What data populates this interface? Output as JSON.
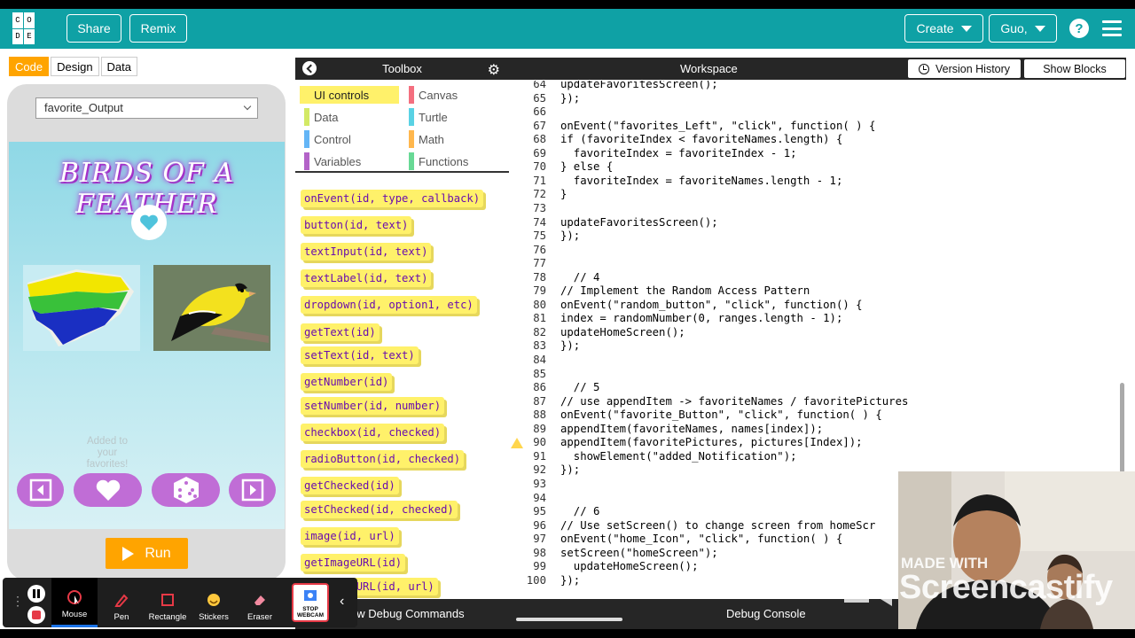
{
  "header": {
    "logo_letters": [
      "C",
      "O",
      "D",
      "E"
    ],
    "share_label": "Share",
    "remix_label": "Remix",
    "create_label": "Create",
    "user_label": "Guo,",
    "help_label": "?"
  },
  "left": {
    "tabs": [
      "Code",
      "Design",
      "Data"
    ],
    "active_tab": "Code",
    "screen_select": "favorite_Output",
    "app_title": "BIRDS OF A FEATHER",
    "added_text": "Added to your favorites!",
    "run_label": "Run"
  },
  "toolbox": {
    "title": "Toolbox",
    "categories": [
      {
        "label": "UI controls",
        "color": "#fff16a"
      },
      {
        "label": "Canvas",
        "color": "#f46f7f"
      },
      {
        "label": "Data",
        "color": "#d3e965"
      },
      {
        "label": "Turtle",
        "color": "#59d2e4"
      },
      {
        "label": "Control",
        "color": "#64b5f6"
      },
      {
        "label": "Math",
        "color": "#ffb74d"
      },
      {
        "label": "Variables",
        "color": "#b363c8"
      },
      {
        "label": "Functions",
        "color": "#68d995"
      }
    ],
    "blocks": [
      "onEvent(id, type, callback)",
      "button(id, text)",
      "textInput(id, text)",
      "textLabel(id, text)",
      "dropdown(id, option1, etc)",
      "getText(id)",
      "setText(id, text)",
      "getNumber(id)",
      "setNumber(id, number)",
      "checkbox(id, checked)",
      "radioButton(id, checked)",
      "getChecked(id)",
      "setChecked(id, checked)",
      "image(id, url)",
      "getImageURL(id)",
      "setImageURL(id, url)"
    ]
  },
  "workspace": {
    "title": "Workspace",
    "version_history_label": "Version History",
    "show_blocks_label": "Show Blocks",
    "lines": [
      {
        "n": "64",
        "t": "updateFavoritesScreen();"
      },
      {
        "n": "65",
        "t": "});"
      },
      {
        "n": "66",
        "t": ""
      },
      {
        "n": "67",
        "t": "onEvent(\"favorites_Left\", \"click\", function( ) {"
      },
      {
        "n": "68",
        "t": "if (favoriteIndex < favoriteNames.length) {"
      },
      {
        "n": "69",
        "t": "  favoriteIndex = favoriteIndex - 1;"
      },
      {
        "n": "70",
        "t": "} else {"
      },
      {
        "n": "71",
        "t": "  favoriteIndex = favoriteNames.length - 1;"
      },
      {
        "n": "72",
        "t": "}"
      },
      {
        "n": "73",
        "t": ""
      },
      {
        "n": "74",
        "t": "updateFavoritesScreen();"
      },
      {
        "n": "75",
        "t": "});"
      },
      {
        "n": "76",
        "t": ""
      },
      {
        "n": "77",
        "t": ""
      },
      {
        "n": "78",
        "t": "  // 4"
      },
      {
        "n": "79",
        "t": "// Implement the Random Access Pattern"
      },
      {
        "n": "80",
        "t": "onEvent(\"random_button\", \"click\", function() {"
      },
      {
        "n": "81",
        "t": "index = randomNumber(0, ranges.length - 1);"
      },
      {
        "n": "82",
        "t": "updateHomeScreen();"
      },
      {
        "n": "83",
        "t": "});"
      },
      {
        "n": "84",
        "t": ""
      },
      {
        "n": "85",
        "t": ""
      },
      {
        "n": "86",
        "t": "  // 5"
      },
      {
        "n": "87",
        "t": "// use appendItem -> favoriteNames / favoritePictures"
      },
      {
        "n": "88",
        "t": "onEvent(\"favorite_Button\", \"click\", function( ) {"
      },
      {
        "n": "89",
        "t": "appendItem(favoriteNames, names[index]);"
      },
      {
        "n": "90",
        "t": "appendItem(favoritePictures, pictures[Index]);"
      },
      {
        "n": "91",
        "t": "  showElement(\"added_Notification\");"
      },
      {
        "n": "92",
        "t": "});"
      },
      {
        "n": "93",
        "t": ""
      },
      {
        "n": "94",
        "t": ""
      },
      {
        "n": "95",
        "t": "  // 6"
      },
      {
        "n": "96",
        "t": "// Use setScreen() to change screen from homeScr"
      },
      {
        "n": "97",
        "t": "onEvent(\"home_Icon\", \"click\", function( ) {"
      },
      {
        "n": "98",
        "t": "setScreen(\"homeScreen\");"
      },
      {
        "n": "99",
        "t": "  updateHomeScreen();"
      },
      {
        "n": "100",
        "t": "});"
      }
    ],
    "warning_line": "90"
  },
  "debug": {
    "commands_label": "ow Debug Commands",
    "console_label": "Debug Console"
  },
  "screencastify": {
    "tools": [
      "Mouse",
      "Pen",
      "Rectangle",
      "Stickers",
      "Eraser"
    ],
    "active_tool": "Mouse",
    "stop_label": "STOP WEBCAM",
    "watermark_top": "MADE WITH",
    "watermark_brand": "Screencastify"
  },
  "colors": {
    "header_bg": "#0fa1a5",
    "accent_orange": "#ffa400",
    "block_yellow": "#fff16a",
    "app_purple": "#c06dd6"
  }
}
